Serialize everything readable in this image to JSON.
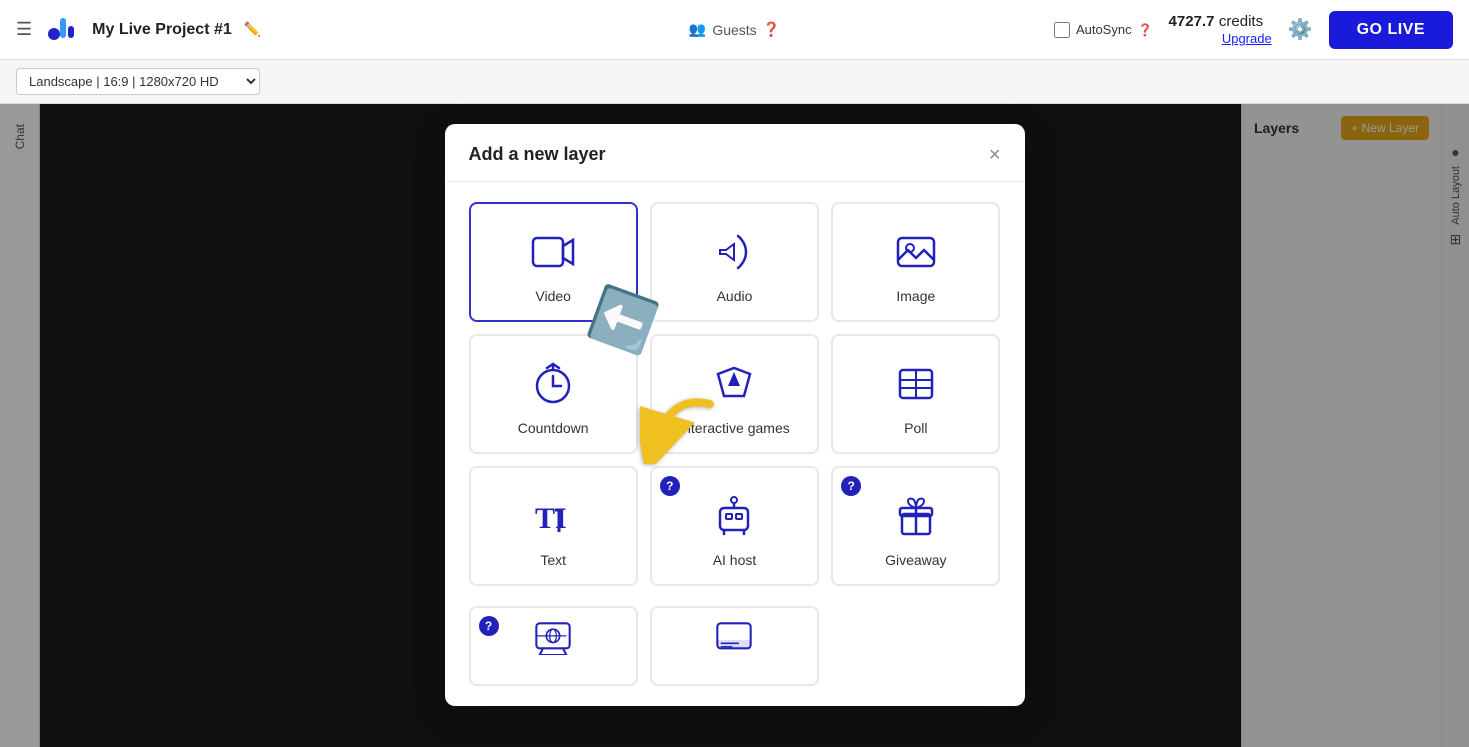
{
  "topbar": {
    "project_title": "My Live Project #1",
    "credits_amount": "4727.7",
    "credits_label": "credits",
    "upgrade_label": "Upgrade",
    "golive_label": "GO LIVE"
  },
  "secondbar": {
    "landscape_option": "Landscape | 16:9 | 1280x720 HD",
    "guests_label": "Guests",
    "autosync_label": "AutoSync"
  },
  "right_panel": {
    "layers_title": "Layers",
    "new_layer_label": "+ New Layer"
  },
  "modal": {
    "title": "Add a new layer",
    "close_label": "×",
    "cards": [
      {
        "id": "video",
        "label": "Video",
        "selected": true,
        "badge": false
      },
      {
        "id": "audio",
        "label": "Audio",
        "selected": false,
        "badge": false
      },
      {
        "id": "image",
        "label": "Image",
        "selected": false,
        "badge": false
      },
      {
        "id": "countdown",
        "label": "Countdown",
        "selected": false,
        "badge": false
      },
      {
        "id": "interactive-games",
        "label": "Interactive games",
        "selected": false,
        "badge": false
      },
      {
        "id": "poll",
        "label": "Poll",
        "selected": false,
        "badge": false
      },
      {
        "id": "text",
        "label": "Text",
        "selected": false,
        "badge": false
      },
      {
        "id": "ai-host",
        "label": "AI host",
        "selected": false,
        "badge": true
      },
      {
        "id": "giveaway",
        "label": "Giveaway",
        "selected": false,
        "badge": true
      }
    ],
    "bottom_cards": [
      {
        "id": "virtual-background",
        "label": "Virtual Background",
        "badge": true
      },
      {
        "id": "lower-thirds",
        "label": "Lower Thirds",
        "badge": false
      }
    ]
  },
  "sidebar": {
    "chat_label": "Chat"
  }
}
